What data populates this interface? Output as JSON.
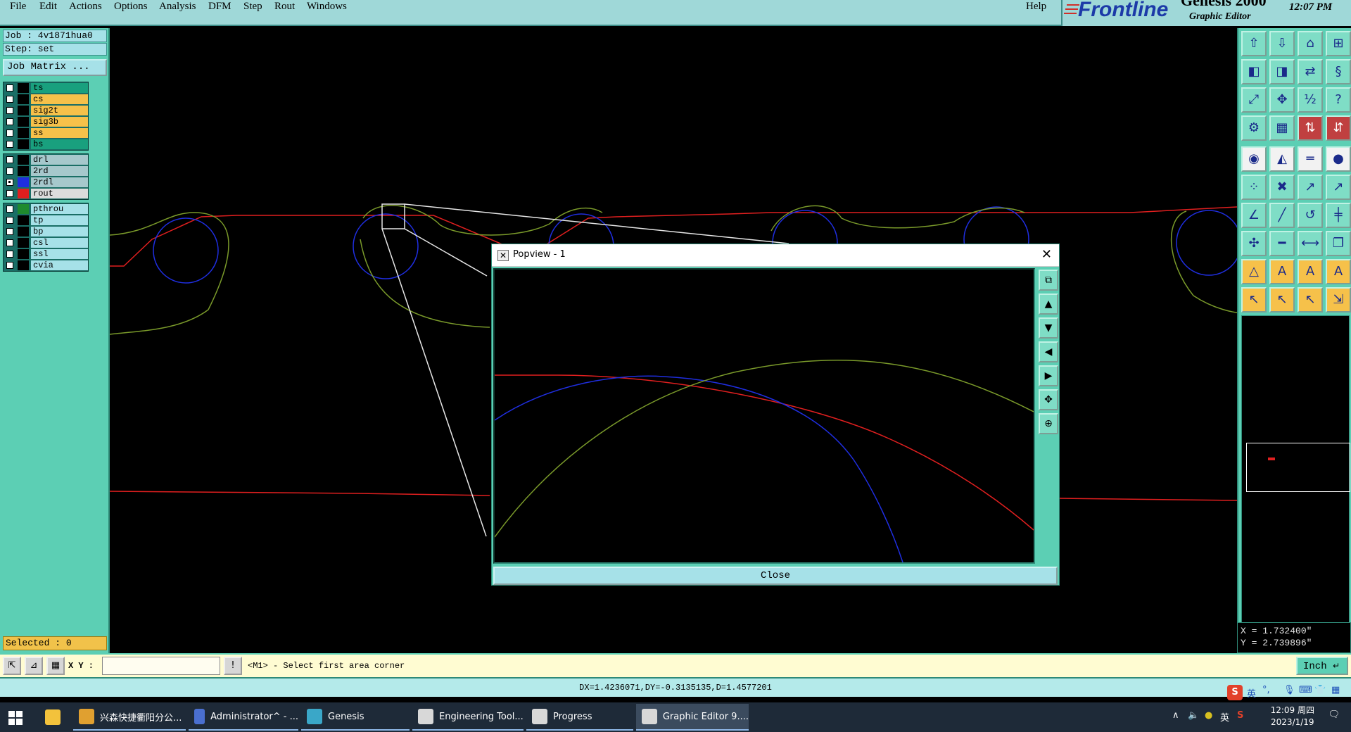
{
  "menu": {
    "items": [
      "File",
      "Edit",
      "Actions",
      "Options",
      "Analysis",
      "DFM",
      "Step",
      "Rout",
      "Windows"
    ],
    "help": "Help"
  },
  "brand": {
    "logo": "Frontline",
    "product": "Genesis 2000",
    "subtitle": "Graphic Editor",
    "time": "12:07 PM"
  },
  "job": {
    "job_label": "Job : 4v1871hua0",
    "step_label": "Step: set",
    "matrix_button": "Job Matrix ...",
    "selected": "Selected : 0"
  },
  "layers": {
    "group1": [
      {
        "name": "ts",
        "color": "#19a07e",
        "swatch": "#000000",
        "checked": false
      },
      {
        "name": "cs",
        "color": "#f6c14a",
        "swatch": "#000000",
        "checked": false
      },
      {
        "name": "sig2t",
        "color": "#f6c14a",
        "swatch": "#000000",
        "checked": false
      },
      {
        "name": "sig3b",
        "color": "#f6c14a",
        "swatch": "#000000",
        "checked": false
      },
      {
        "name": "ss",
        "color": "#f6c14a",
        "swatch": "#000000",
        "checked": false
      },
      {
        "name": "bs",
        "color": "#19a07e",
        "swatch": "#000000",
        "checked": false
      }
    ],
    "group2": [
      {
        "name": "drl",
        "color": "#a6c8cc",
        "swatch": "#000000",
        "checked": false
      },
      {
        "name": "2rd",
        "color": "#a6c8cc",
        "swatch": "#000000",
        "checked": false
      },
      {
        "name": "2rdl",
        "color": "#a6c8cc",
        "swatch": "#1f2ee0",
        "checked": true
      },
      {
        "name": "rout",
        "color": "#dcdcdc",
        "swatch": "#e01f1f",
        "checked": false
      }
    ],
    "group3": [
      {
        "name": "pthrou",
        "color": "#a6e1e8",
        "swatch": "#1f8a2e",
        "checked": false
      },
      {
        "name": "tp",
        "color": "#a6e1e8",
        "swatch": "#000000",
        "checked": false
      },
      {
        "name": "bp",
        "color": "#a6e1e8",
        "swatch": "#000000",
        "checked": false
      },
      {
        "name": "csl",
        "color": "#a6e1e8",
        "swatch": "#000000",
        "checked": false
      },
      {
        "name": "ssl",
        "color": "#a6e1e8",
        "swatch": "#000000",
        "checked": false
      },
      {
        "name": "cvia",
        "color": "#a6e1e8",
        "swatch": "#000000",
        "checked": false
      }
    ]
  },
  "popview": {
    "title": "Popview - 1",
    "close_label": "Close"
  },
  "coords": {
    "x": "X = 1.732400\"",
    "y": "Y = 2.739896\""
  },
  "command": {
    "xy_label": "X Y :",
    "xy_value": "",
    "prompt": "<M1> - Select first area corner",
    "unit": "Inch"
  },
  "status": {
    "measure": "DX=1.4236071,DY=-0.3135135,D=1.4577201"
  },
  "ime": {
    "lang": "英"
  },
  "taskbar": {
    "items": [
      {
        "label": "兴森快捷衢阳分公...",
        "icon_color": "#e0a030"
      },
      {
        "label": "Administrator^ - ...",
        "icon_color": "#4a6fd0"
      },
      {
        "label": "Genesis",
        "icon_color": "#3aa7c8"
      },
      {
        "label": "Engineering Tool...",
        "icon_color": "#d8d8d8"
      },
      {
        "label": "Progress",
        "icon_color": "#d8d8d8"
      },
      {
        "label": "Graphic Editor 9....",
        "icon_color": "#d8d8d8"
      }
    ],
    "tray_lang": "英",
    "clock_time": "12:09 周四",
    "clock_date": "2023/1/19"
  },
  "colors": {
    "panel": "#5ccfb4",
    "canvas": "#000000",
    "rout_line": "#e01f1f",
    "drill_circle": "#1f2ee0",
    "outline": "#7a9a2a"
  }
}
